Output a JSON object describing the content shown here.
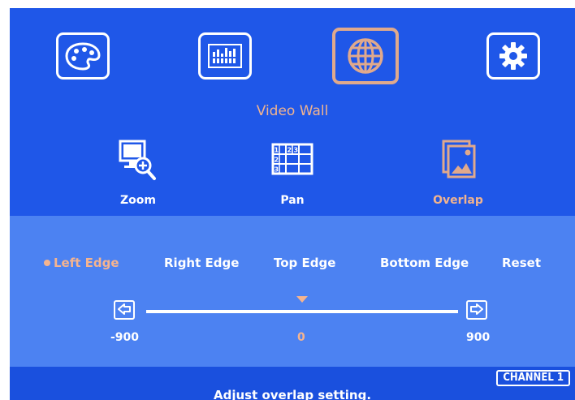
{
  "top_menu": {
    "title": "Video Wall",
    "items": [
      {
        "icon": "palette-icon"
      },
      {
        "icon": "equalizer-icon"
      },
      {
        "icon": "globe-icon",
        "selected": true
      },
      {
        "icon": "gear-icon"
      }
    ]
  },
  "submenu": {
    "zoom_label": "Zoom",
    "pan_label": "Pan",
    "overlap_label": "Overlap",
    "selected": "Overlap",
    "pan_grid_numbers": [
      "1",
      "2",
      "3",
      "2",
      "3"
    ]
  },
  "edges": {
    "left": "Left Edge",
    "right": "Right Edge",
    "top": "Top Edge",
    "bottom": "Bottom Edge",
    "reset": "Reset",
    "selected": "Left Edge"
  },
  "slider": {
    "min": "-900",
    "value": "0",
    "max": "900"
  },
  "footer": {
    "channel": "CHANNEL 1",
    "status": "Adjust overlap setting."
  },
  "colors": {
    "background": "#1d55e6",
    "panel": "#4c82f2",
    "accent": "#f5b48f"
  }
}
